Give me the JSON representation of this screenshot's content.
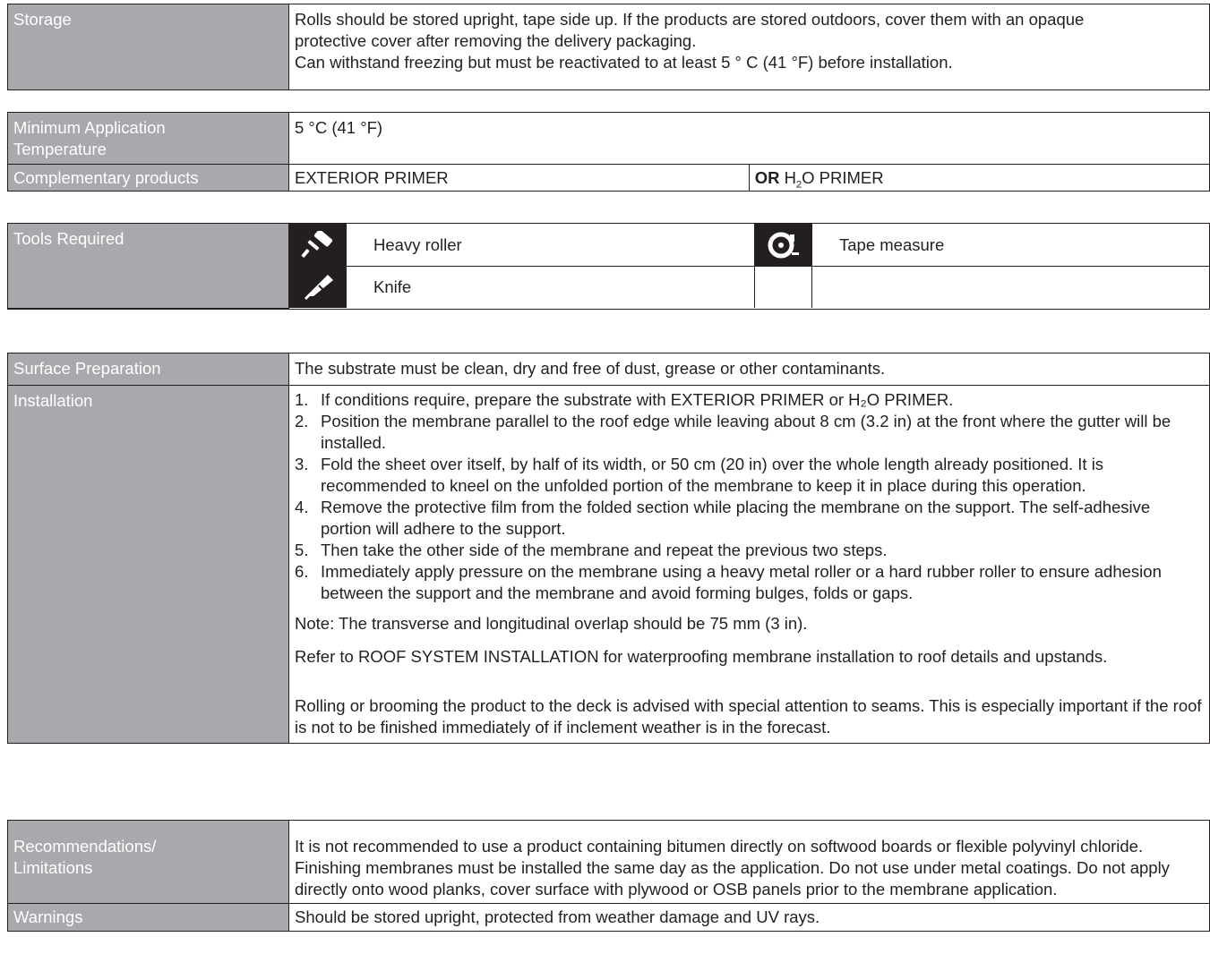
{
  "storage": {
    "label": "Storage",
    "lines": [
      "Rolls should be stored upright, tape side up. If the products are stored outdoors, cover them with an opaque",
      "protective cover after removing the delivery packaging.",
      "Can withstand freezing but must be reactivated to at least 5 ° C (41 °F) before installation."
    ]
  },
  "min_temp": {
    "label_line1": "Minimum Application",
    "label_line2": "Temperature",
    "value": "5 °C (41 °F)"
  },
  "complementary": {
    "label": "Complementary products",
    "product1": "EXTERIOR PRIMER",
    "or_word": "OR",
    "product2_prefix": "H",
    "product2_sub": "2",
    "product2_suffix": "O PRIMER"
  },
  "tools": {
    "label": "Tools Required",
    "items": [
      {
        "name": "Heavy roller",
        "icon": "paint-roller-icon"
      },
      {
        "name": "Tape measure",
        "icon": "tape-measure-icon"
      },
      {
        "name": "Knife",
        "icon": "utility-knife-icon"
      },
      {
        "name": "",
        "icon": ""
      }
    ]
  },
  "surface": {
    "label": "Surface Preparation",
    "value": "The substrate must be clean, dry and free of dust, grease or other contaminants."
  },
  "installation": {
    "label": "Installation",
    "steps": [
      {
        "num": "1.",
        "text": "If conditions require, prepare the substrate with EXTERIOR PRIMER or H₂O PRIMER."
      },
      {
        "num": "2.",
        "text": "Position the membrane parallel to the roof edge while leaving about 8 cm (3.2 in) at the front where the gutter will be installed."
      },
      {
        "num": "3.",
        "text": "Fold the sheet over itself, by half of its width, or 50 cm (20 in) over the whole length already positioned. It is recommended to kneel on the unfolded portion of the membrane to keep it in place during this operation."
      },
      {
        "num": "4.",
        "text": "Remove the protective film from the folded section while placing the membrane on the support. The self-adhesive portion will adhere to the support."
      },
      {
        "num": "5.",
        "text": "Then take the other side of the membrane and repeat the previous two steps."
      },
      {
        "num": "6.",
        "text": "Immediately apply pressure on the membrane using a heavy metal roller or a hard rubber roller to ensure adhesion between the support and the membrane and avoid forming bulges, folds or gaps."
      }
    ],
    "note": "Note: The transverse and longitudinal overlap should be 75 mm (3 in).",
    "refer": "Refer to ROOF SYSTEM INSTALLATION for waterproofing membrane installation to roof details and upstands.",
    "rolling": "Rolling or brooming the product to the deck is advised with special attention to seams. This is especially important if the roof is not to be finished immediately of if inclement weather is in the forecast."
  },
  "recommendations": {
    "label_line1": "Recommendations/",
    "label_line2": "Limitations",
    "value": "It is not recommended to use a product containing bitumen directly on softwood boards or flexible polyvinyl chloride. Finishing membranes must be installed the same day as the application. Do not use under metal coatings. Do not apply directly onto wood planks, cover surface with plywood or OSB panels prior to the membrane application."
  },
  "warnings": {
    "label": "Warnings",
    "value": "Should be stored upright, protected from weather damage and UV rays."
  },
  "colors": {
    "label_bg": "#a7a9ac",
    "border": "#231f20",
    "icon_bg": "#231f20",
    "text": "#231f20"
  }
}
